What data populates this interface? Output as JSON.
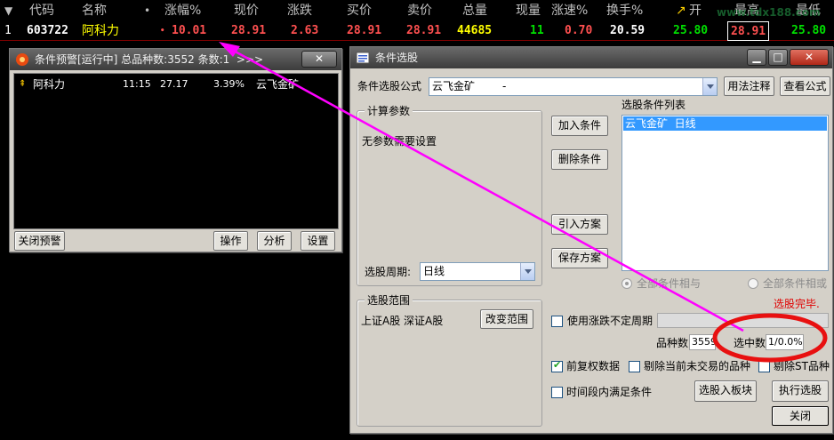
{
  "quote": {
    "headers": {
      "code": "代码",
      "name": "名称",
      "dot": "•",
      "change_pct": "涨幅%",
      "price": "现价",
      "change": "涨跌",
      "bid": "买价",
      "ask": "卖价",
      "volume": "总量",
      "cur_vol": "现量",
      "speed": "涨速%",
      "turnover": "换手%",
      "open": "开",
      "high": "最高",
      "low": "最低"
    },
    "row": {
      "index": "1",
      "code": "603722",
      "name": "阿科力",
      "change_pct": "10.01",
      "price": "28.91",
      "change": "2.63",
      "bid": "28.91",
      "ask": "28.91",
      "volume": "44685",
      "cur_vol": "11",
      "speed": "0.70",
      "turnover": "20.59",
      "open": "25.80",
      "high": "28.91",
      "low": "25.80"
    },
    "watermark": "www.tdx188.com"
  },
  "alert_window": {
    "title": "条件预警[运行中] 总品种数:3552 条数:1",
    "arrows": ">>>",
    "close": "✕",
    "item": {
      "name": "阿科力",
      "time": "11:15",
      "price": "27.17",
      "pct": "3.39%",
      "condition": "云飞金矿"
    },
    "buttons": {
      "close_alert": "关闭预警",
      "operate": "操作",
      "analyze": "分析",
      "settings": "设置"
    }
  },
  "dialog": {
    "title": "条件选股",
    "win_min": "▁",
    "win_max": "□",
    "win_close": "✕",
    "formula_label": "条件选股公式",
    "formula_value": "云飞金矿",
    "formula_dash": "-",
    "usage_btn": "用法注释",
    "view_btn": "查看公式",
    "params_group": "计算参数",
    "no_params": "无参数需要设置",
    "add_cond": "加入条件",
    "del_cond": "删除条件",
    "import_plan": "引入方案",
    "save_plan": "保存方案",
    "cond_list_label": "选股条件列表",
    "cond_list": [
      "云飞金矿  日线"
    ],
    "period_label": "选股周期:",
    "period_value": "日线",
    "and_label": "全部条件相与",
    "or_label": "全部条件相或",
    "status": "选股完毕.",
    "range_group": "选股范围",
    "range_value": "上证A股  深证A股",
    "change_range": "改变范围",
    "use_irregular": "使用涨跌不定周期",
    "total_label": "品种数",
    "total_value": "3559",
    "selected_label": "选中数",
    "selected_value": "1/0.0%",
    "pre_adjust": "前复权数据",
    "exclude_untraded": "剔除当前未交易的品种",
    "exclude_st": "剔除ST品种",
    "time_range": "时间段内满足条件",
    "to_block": "选股入板块",
    "execute": "执行选股",
    "close": "关闭"
  },
  "colors": {
    "annotation_magenta": "#ff00ff",
    "annotation_red": "#e00000"
  }
}
